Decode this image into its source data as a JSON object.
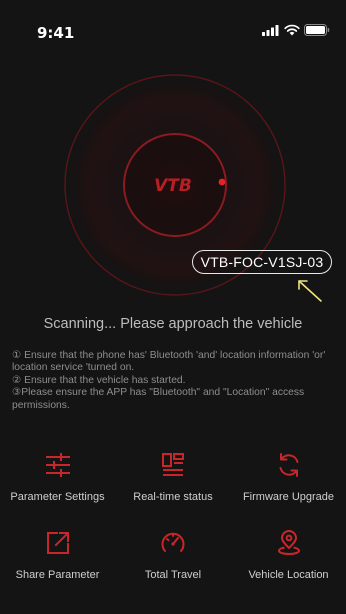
{
  "status_bar": {
    "time": "9:41",
    "icons": [
      "signal-icon",
      "wifi-icon",
      "battery-icon"
    ]
  },
  "scanner": {
    "logo_text": "VTB",
    "device_name": "VTB-FOC-V1SJ-03",
    "accent_color": "#e0242b"
  },
  "scanning_message": "Scanning... Please approach the vehicle",
  "notes": [
    "① Ensure that the phone has' Bluetooth 'and' location information 'or' location service 'turned on.",
    "② Ensure that the vehicle has started.",
    "③Please ensure the APP has \"Bluetooth\" and \"Location\" access permissions."
  ],
  "features": [
    {
      "label": "Parameter Settings",
      "icon": "sliders-icon"
    },
    {
      "label": "Real-time status",
      "icon": "dashboard-icon"
    },
    {
      "label": "Firmware Upgrade",
      "icon": "refresh-icon"
    },
    {
      "label": "Share Parameter",
      "icon": "share-icon"
    },
    {
      "label": "Total Travel",
      "icon": "speedometer-icon"
    },
    {
      "label": "Vehicle Location",
      "icon": "location-pin-icon"
    }
  ]
}
